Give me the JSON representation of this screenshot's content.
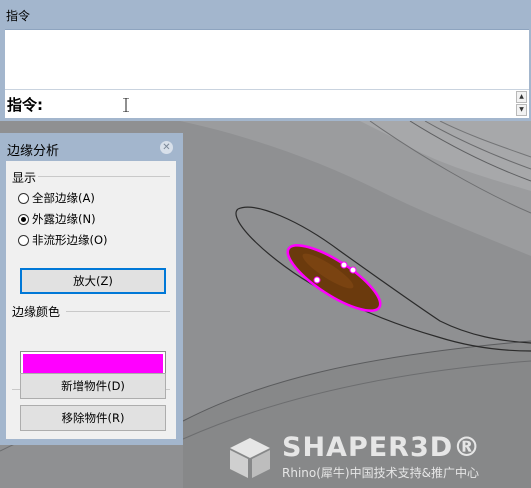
{
  "command": {
    "panel_title": "指令",
    "prompt": "指令:"
  },
  "dialog": {
    "title": "边缘分析",
    "display_group": "显示",
    "options": [
      {
        "label": "全部边缘(A)",
        "selected": false
      },
      {
        "label": "外露边缘(N)",
        "selected": true
      },
      {
        "label": "非流形边缘(O)",
        "selected": false
      }
    ],
    "zoom_button": "放大(Z)",
    "color_group": "边缘颜色",
    "edge_color": "#ff00ff",
    "add_button": "新增物件(D)",
    "remove_button": "移除物件(R)"
  },
  "watermark": {
    "brand": "SHAPER3D®",
    "subtitle": "Rhino(犀牛)中国技术支持&推广中心"
  },
  "colors": {
    "panel": "#a3b6cd",
    "viewport": "#8f9092",
    "hole_fill": "#6b3a0d",
    "highlight": "#ff00ff"
  },
  "icons": {
    "close": "close-icon",
    "cursor": "text-cursor-icon",
    "scroll_up": "scroll-up-icon",
    "scroll_down": "scroll-down-icon",
    "logo": "shaper3d-logo-icon"
  }
}
